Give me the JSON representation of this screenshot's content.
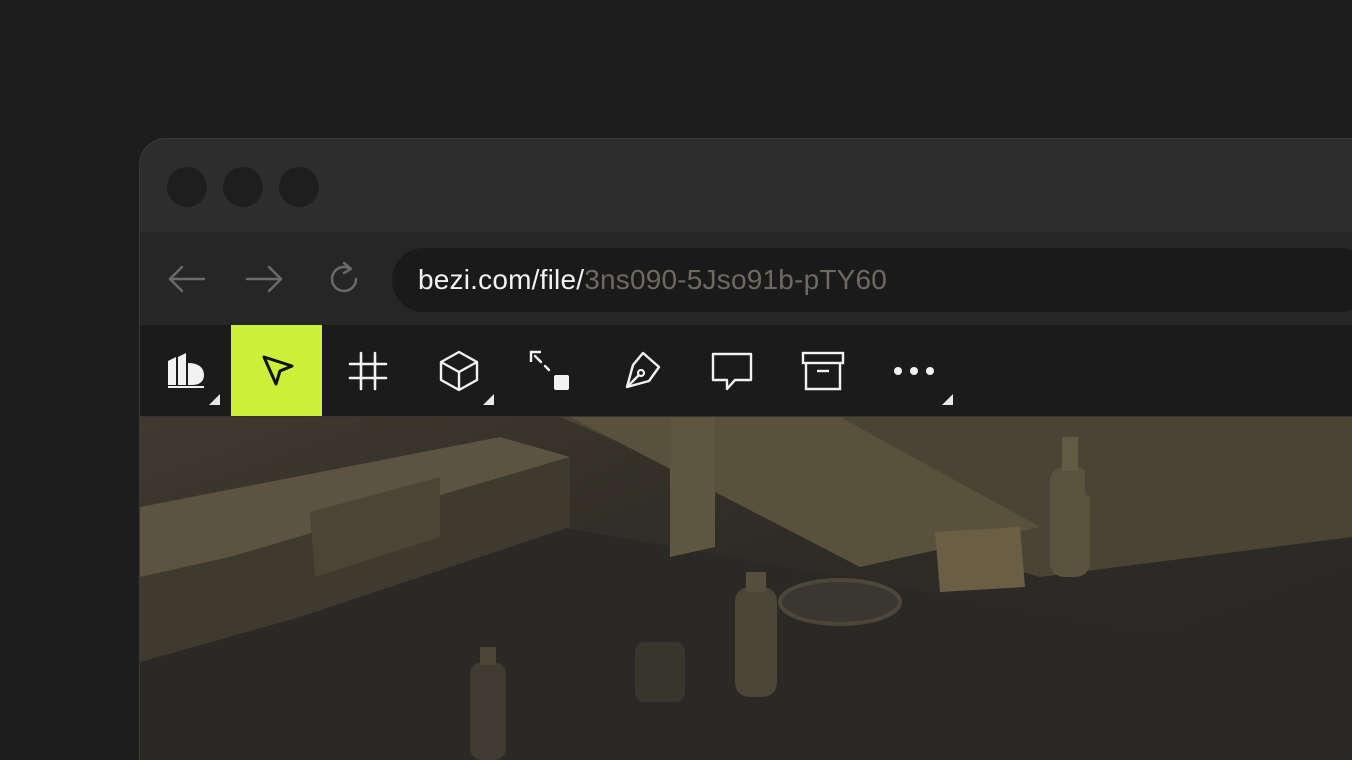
{
  "browser": {
    "url_prefix": "bezi.com/file/",
    "url_id": "3ns090-5Jso91b-pTY60"
  },
  "icons": {
    "back": "arrow-left-icon",
    "forward": "arrow-right-icon",
    "reload": "reload-icon",
    "logo": "bezi-logo-icon",
    "select": "cursor-icon",
    "frame": "frame-hash-icon",
    "object": "cube-icon",
    "transform": "scale-resize-icon",
    "pen": "pen-tool-icon",
    "comment": "comment-icon",
    "archive": "archive-box-icon",
    "more": "more-dots-icon"
  },
  "colors": {
    "accent": "#ccef3a",
    "background": "#1d1d1d",
    "toolbar": "#1b1b1b"
  }
}
